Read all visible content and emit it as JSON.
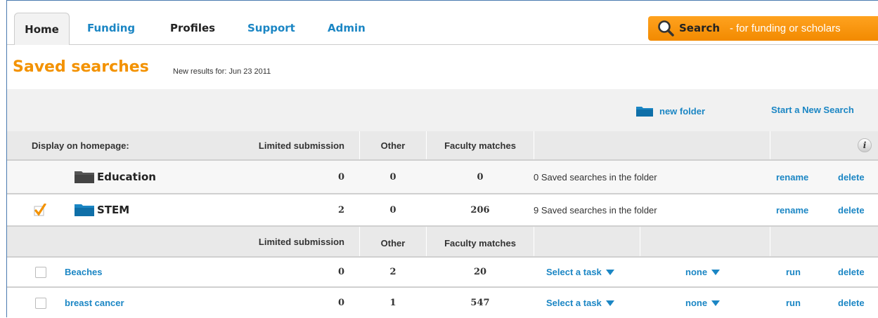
{
  "nav": {
    "tabs": [
      {
        "label": "Home"
      },
      {
        "label": "Funding"
      },
      {
        "label": "Profiles"
      },
      {
        "label": "Support"
      },
      {
        "label": "Admin"
      }
    ],
    "search_label": "Search",
    "search_sub": " - for funding or scholars"
  },
  "page": {
    "title": "Saved searches",
    "subtitle": "New results for: Jun 23 2011"
  },
  "toolbar": {
    "new_folder": "new folder",
    "start_new_search": "Start a New Search"
  },
  "folder_header": {
    "display": "Display on homepage:",
    "limited": "Limited submission",
    "other": "Other",
    "faculty": "Faculty matches",
    "info": "i"
  },
  "folders": [
    {
      "name": "Education",
      "limited": "0",
      "other": "0",
      "faculty": "0",
      "count_text": "0 Saved searches in the folder",
      "rename": "rename",
      "delete": "delete",
      "checked": false
    },
    {
      "name": "STEM",
      "limited": "2",
      "other": "0",
      "faculty": "206",
      "count_text": "9 Saved searches in the folder",
      "rename": "rename",
      "delete": "delete",
      "checked": true
    }
  ],
  "search_header": {
    "limited": "Limited submission",
    "other": "Other",
    "faculty": "Faculty matches"
  },
  "searches": [
    {
      "name": "Beaches",
      "limited": "0",
      "other": "2",
      "faculty": "20",
      "task": "Select a task",
      "freq": "none",
      "run": "run",
      "delete": "delete"
    },
    {
      "name": "breast cancer",
      "limited": "0",
      "other": "1",
      "faculty": "547",
      "task": "Select a task",
      "freq": "none",
      "run": "run",
      "delete": "delete"
    }
  ],
  "colors": {
    "accent": "#f39200",
    "link": "#1b86c4"
  }
}
